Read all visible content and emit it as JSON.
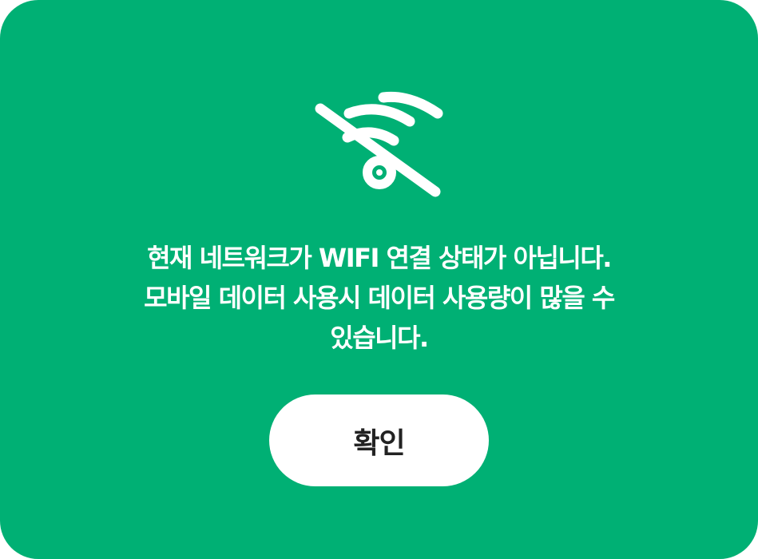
{
  "dialog": {
    "icon": "wifi-off-icon",
    "message_lines": [
      "현재 네트워크가 WIFI 연결 상태가 아닙니다.",
      "모바일 데이터 사용시 데이터 사용량이 많을 수",
      "있습니다."
    ],
    "confirm_label": "확인"
  },
  "colors": {
    "background": "#00b074",
    "text": "#ffffff",
    "button_background": "#ffffff",
    "button_text": "#222222"
  }
}
